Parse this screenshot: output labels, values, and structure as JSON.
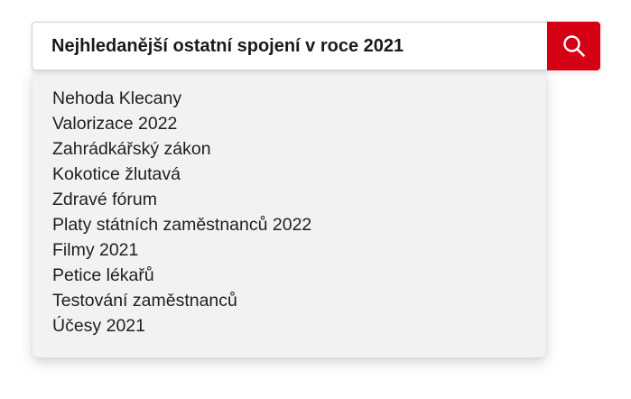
{
  "search": {
    "query": "Nejhledanější ostatní spojení v roce 2021",
    "button_icon": "search-icon",
    "button_color": "#d60014"
  },
  "suggestions": [
    "Nehoda Klecany",
    "Valorizace 2022",
    "Zahrádkářský zákon",
    "Kokotice žlutavá",
    "Zdravé fórum",
    "Platy státních zaměstnanců 2022",
    "Filmy 2021",
    "Petice lékařů",
    "Testování zaměstnanců",
    "Účesy 2021"
  ]
}
